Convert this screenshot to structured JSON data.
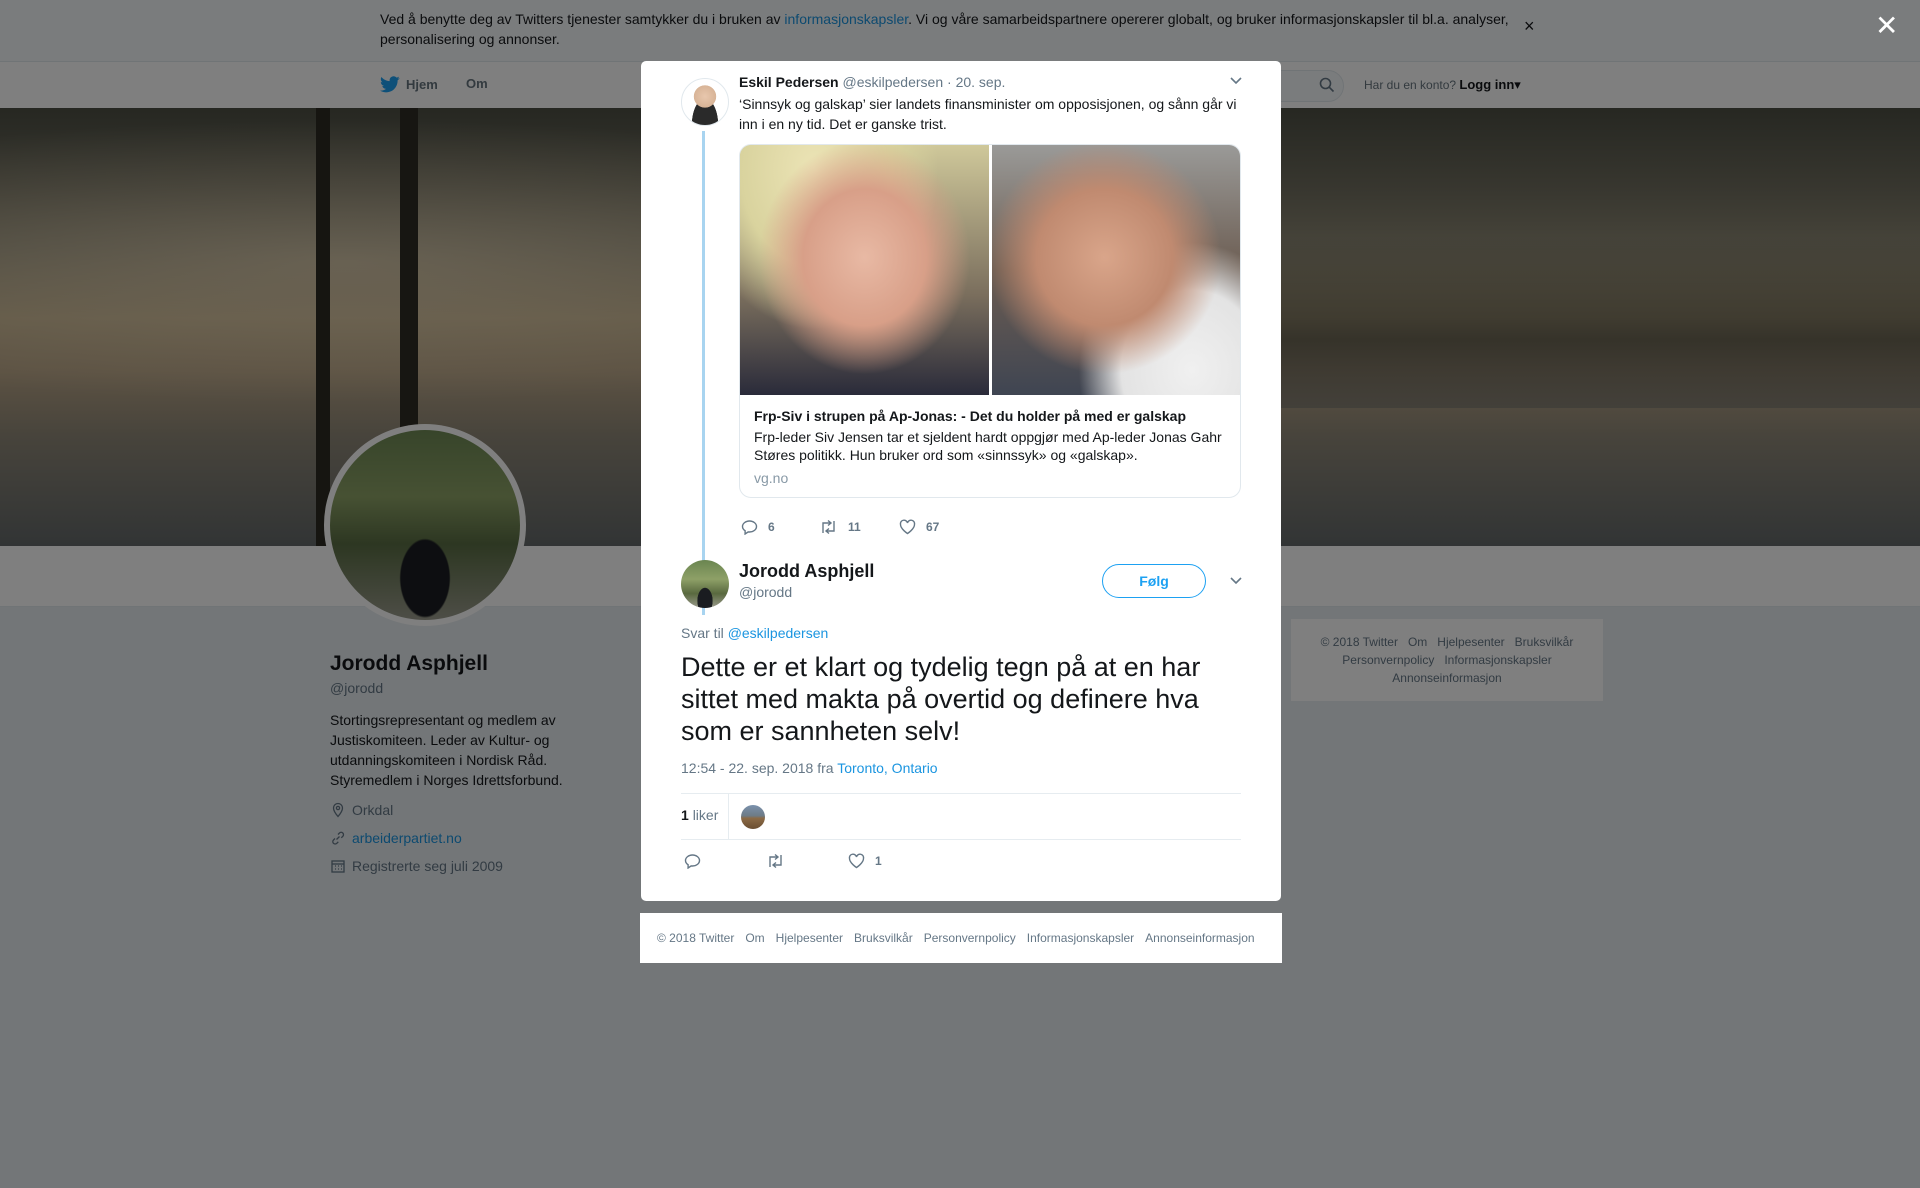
{
  "cookie_bar": {
    "text_before": "Ved å benytte deg av Twitters tjenester samtykker du i bruken av ",
    "link": "informasjonskapsler",
    "text_after": ". Vi og våre samarbeidspartnere opererer globalt, og bruker informasjonskapsler til bl.a. analyser, personalisering og annonser.",
    "close": "×"
  },
  "nav": {
    "home": "Hjem",
    "about": "Om",
    "have_account": "Har du en konto?",
    "login": "Logg inn",
    "login_caret": "▾"
  },
  "profile": {
    "name": "Jorodd Asphjell",
    "handle": "@jorodd",
    "bio": "Stortingsrepresentant og medlem av Justiskomiteen. Leder av Kultur- og utdanningskomiteen i Nordisk Råd. Styremedlem i Norges Idrettsforbund.",
    "location": "Orkdal",
    "website": "arbeiderpartiet.no",
    "joined": "Registrerte seg juli 2009"
  },
  "side_footer": [
    "© 2018 Twitter",
    "Om",
    "Hjelpesenter",
    "Bruksvilkår",
    "Personvernpolicy",
    "Informasjonskapsler",
    "Annonseinformasjon"
  ],
  "modal_close": "✕",
  "parent_tweet": {
    "name": "Eskil Pedersen",
    "handle": "@eskilpedersen",
    "date": "· 20. sep.",
    "text": "‘Sinnsyk og galskap’ sier landets finansminister om opposisjonen, og sånn går vi inn i en ny tid. Det er ganske trist.",
    "card": {
      "title": "Frp-Siv i strupen på Ap-Jonas: - Det du holder på med er galskap",
      "description": "Frp-leder Siv Jensen tar et sjeldent hardt oppgjør med Ap-leder Jonas Gahr Støres politikk. Hun bruker ord som «sinnssyk» og «galskap».",
      "domain": "vg.no"
    },
    "replies": "6",
    "retweets": "11",
    "likes": "67"
  },
  "main_tweet": {
    "name": "Jorodd Asphjell",
    "handle": "@jorodd",
    "follow": "Følg",
    "reply_to_label": "Svar til",
    "reply_to_handle": "@eskilpedersen",
    "text": "Dette er et klart og tydelig tegn på at en har sittet med makta på overtid og definere hva som er sannheten selv!",
    "timestamp": "12:54 - 22. sep. 2018 fra",
    "location": "Toronto, Ontario",
    "like_count": "1",
    "likes_label": "liker",
    "action_likes": "1"
  },
  "bottom_footer": [
    "© 2018 Twitter",
    "Om",
    "Hjelpesenter",
    "Bruksvilkår",
    "Personvernpolicy",
    "Informasjonskapsler",
    "Annonseinformasjon"
  ],
  "colors": {
    "accent": "#1da1f2",
    "link": "#1b95e0",
    "muted": "#657786",
    "thread": "#a8d4f0"
  },
  "icons": {
    "twitter": "twitter-bird-icon",
    "search": "search-icon",
    "location": "location-pin-icon",
    "link": "link-icon",
    "calendar": "calendar-icon",
    "reply": "reply-icon",
    "retweet": "retweet-icon",
    "like": "heart-icon",
    "chevron": "chevron-down-icon"
  }
}
